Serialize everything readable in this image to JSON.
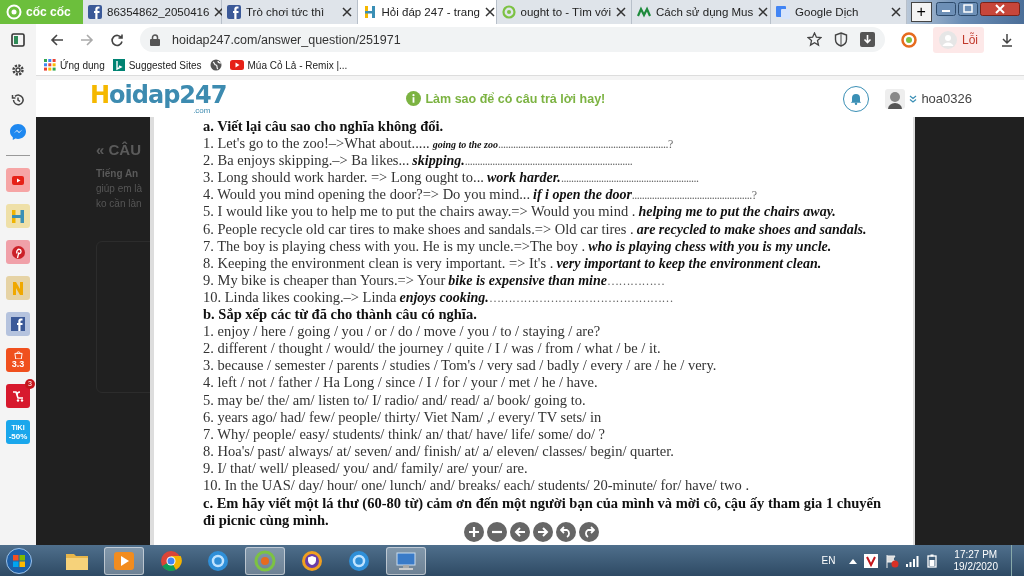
{
  "browser": {
    "logo": "cốc cốc",
    "tabs": [
      {
        "label": "86354862_2050416",
        "kind": "facebook",
        "selected": false
      },
      {
        "label": "Trò chơi tức thì",
        "kind": "facebook",
        "selected": false
      },
      {
        "label": "Hỏi đáp 247 - trang",
        "kind": "hoidap",
        "selected": true
      },
      {
        "label": "ought to - Tìm với",
        "kind": "search",
        "selected": false
      },
      {
        "label": "Cách sử dụng Mus",
        "kind": "mus",
        "selected": false
      },
      {
        "label": "Google Dịch",
        "kind": "translate",
        "selected": false
      }
    ],
    "new_tab": "+",
    "address": "hoidap247.com/answer_question/251971",
    "profile": "Lỗi",
    "bookmarks": [
      {
        "kind": "apps",
        "label": "Ứng dụng"
      },
      {
        "kind": "bing",
        "label": "Suggested Sites"
      },
      {
        "kind": "globe"
      },
      {
        "kind": "youtube",
        "label": "Múa Cỏ Lả - Remix |..."
      }
    ]
  },
  "sidebar": {
    "apps": [
      {
        "kind": "youtube"
      },
      {
        "kind": "hoidap"
      },
      {
        "kind": "pinterest"
      },
      {
        "kind": "n"
      },
      {
        "kind": "facebook"
      },
      {
        "kind": "shopee",
        "text": "3.3"
      },
      {
        "kind": "sendo",
        "badge": "3"
      },
      {
        "kind": "tiki",
        "text": "TIKI",
        "sub": "-50%"
      }
    ]
  },
  "header": {
    "logo": "Hoidap247",
    "logo_suffix": ".com",
    "tip": "Làm sao để có câu trả lời hay!",
    "username": "hoa0326"
  },
  "background_page": {
    "heading": "« CÂU",
    "subject": "Tiếng An",
    "lines": [
      "giúp em là",
      "ko cần làn"
    ]
  },
  "document": {
    "section_a": "a. Viết lại câu sao cho nghĩa không đổi.",
    "items_a": [
      {
        "text": "1. Let's go to the zoo!–>What about.....",
        "answer": "going to the zoo",
        "tail": "....................................................................?",
        "small": true
      },
      {
        "text": "2. Ba enjoys skipping.–> Ba likes...",
        "answer": "skipping.",
        "tail": "..................................................................."
      },
      {
        "text": "3. Long should work harder. => Long ought to...",
        "answer": "work harder.",
        "tail": "......................................................."
      },
      {
        "text": "4. Would you mind opening the door?=> Do you mind...",
        "answer": "if i open the door",
        "tail": "................................................?"
      },
      {
        "text": "5. I would like you to help me to put the chairs away.=> Would you mind .",
        "answer": "helping me to put the chairs away."
      },
      {
        "text": "6. People recycle old car tires to make shoes and sandals.=> Old car tires .",
        "answer": "are recycled to make shoes and sandals."
      },
      {
        "text": "7. The boy is playing chess with you. He is my uncle.=>The boy .",
        "answer": "who is playing chess with you is my uncle."
      },
      {
        "text": "8. Keeping the environment clean is very important. => It's .",
        "answer": "very important to keep the environment clean."
      },
      {
        "text": "9. My bike is cheaper  than Yours.=> Your",
        "answer": "bike is expensive than mine",
        "tail": "……………"
      },
      {
        "text": "10. Linda likes cooking.–> Linda",
        "answer": "enjoys cooking.",
        "tail": "…………………………………………"
      }
    ],
    "section_b": "b. Sắp xếp các từ đã cho thành câu có nghĩa.",
    "items_b": [
      "1. enjoy / here / going / you / or / do / move / you / to / staying / are?",
      "2. different / thought / would/ the journey / quite / I / was / from / what / be / it.",
      "3. because / semester / parents / studies / Tom's / very sad / badly / every / are / he / very.",
      "4. left / not / father / Ha Long / since / I / for / your / met / he / have.",
      "5. may be/ the/ am/ listen to/ I/ radio/ and/ read/ a/ book/ going to.",
      "6. years ago/ had/ few/ people/ thirty/ Viet Nam/ ,/ every/ TV sets/ in",
      "7. Why/ people/ easy/ students/ think/ an/ that/ have/ life/ some/ do/ ?",
      "8. Hoa's/ past/ always/ at/ seven/ and/ finish/ at/ a/ eleven/ classes/ begin/ quarter.",
      "9. I/ that/ well/ pleased/ you/ and/ family/ are/ your/ are.",
      "10. In the UAS/ day/ hour/ one/ lunch/ and/ breaks/ each/ students/ 20-minute/ for/ have/ two ."
    ],
    "section_c": "c.  Em hãy viết một lá thư (60-80 từ) cảm ơn đến một người bạn của mình và mời cô, cậu ấy tham gia 1 chuyến đi picnic cùng mình."
  },
  "viewer_controls": [
    {
      "kind": "zoom-in"
    },
    {
      "kind": "zoom-out"
    },
    {
      "kind": "prev"
    },
    {
      "kind": "next"
    },
    {
      "kind": "rotate-left"
    },
    {
      "kind": "rotate-right"
    }
  ],
  "taskbar": {
    "apps": [
      {
        "kind": "folder",
        "active": false
      },
      {
        "kind": "media",
        "active": true
      },
      {
        "kind": "chrome",
        "active": false
      },
      {
        "kind": "bluecircle",
        "active": false
      },
      {
        "kind": "coccoc",
        "active": true
      },
      {
        "kind": "shield",
        "active": false
      },
      {
        "kind": "bluecircle",
        "active": false
      },
      {
        "kind": "network",
        "active": true
      }
    ],
    "language": "EN",
    "time": "17:27 PM",
    "date": "19/2/2020"
  }
}
